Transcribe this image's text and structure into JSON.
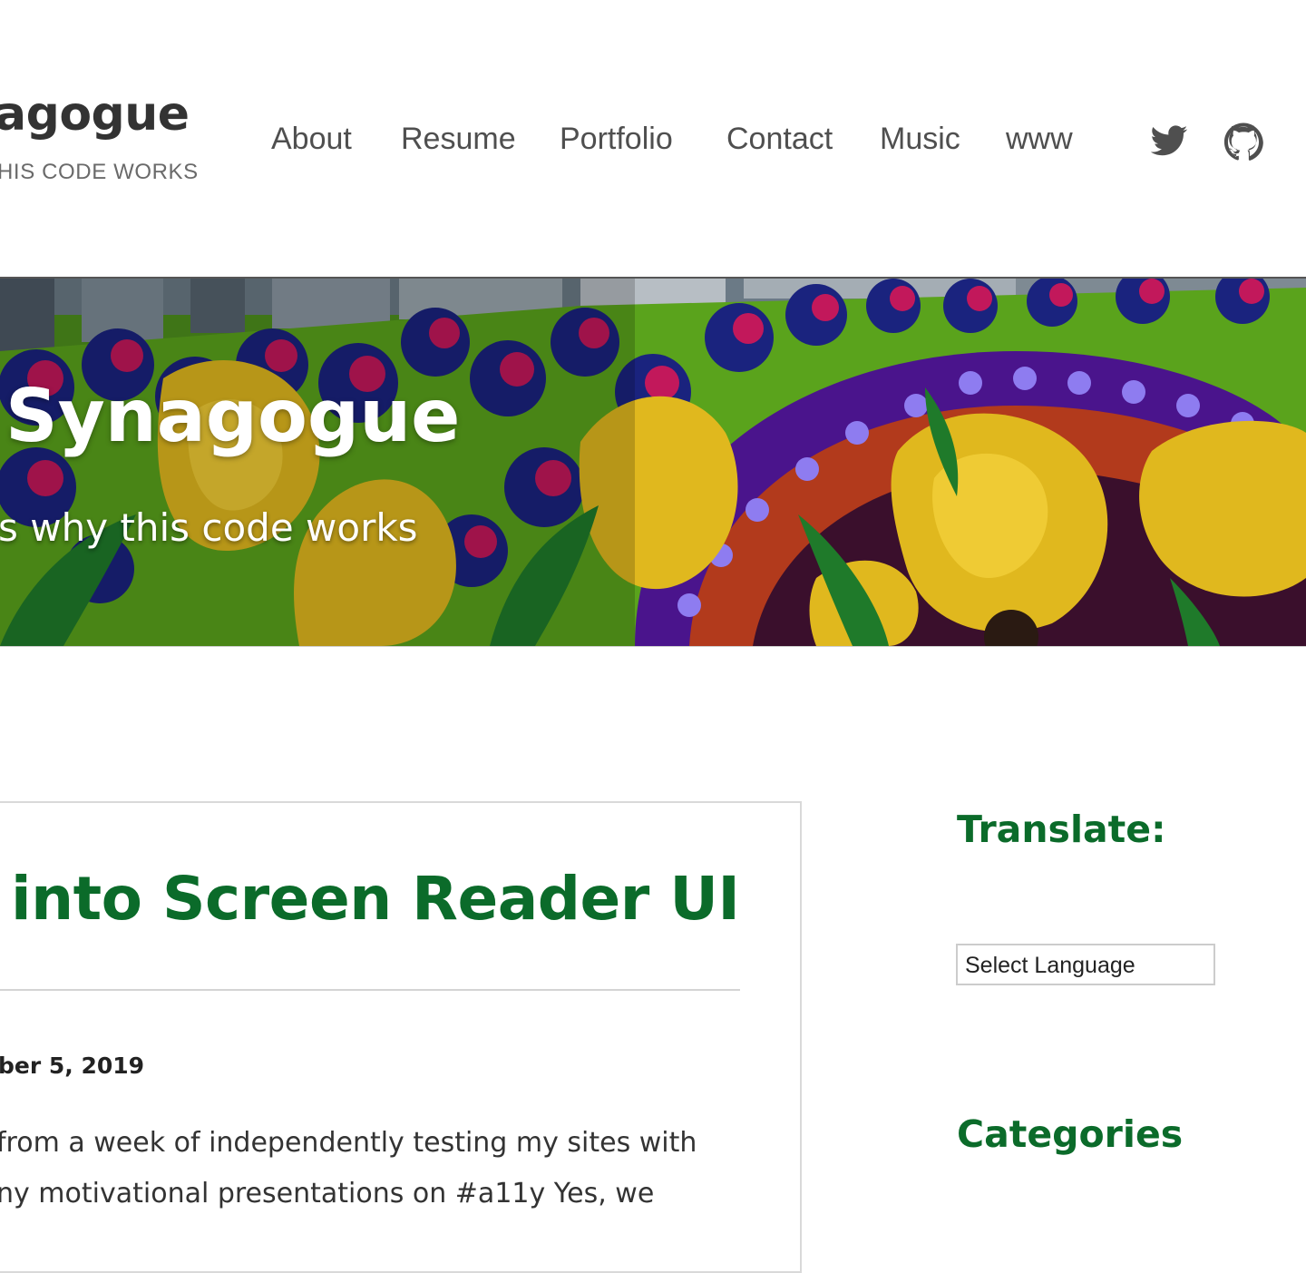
{
  "header": {
    "site_title": "agogue",
    "tagline": "HIS CODE WORKS",
    "nav": [
      "About",
      "Resume",
      "Portfolio",
      "Contact",
      "Music",
      "www"
    ],
    "social_icons": [
      "twitter-icon",
      "github-icon"
    ]
  },
  "hero": {
    "title": "Synagogue",
    "subtitle": "s why this code works"
  },
  "article": {
    "title": "into Screen Reader UI",
    "date": "ber 5, 2019",
    "excerpt_lines": [
      "from a week of independently testing my sites with",
      "ny motivational presentations on #a11y Yes, we"
    ]
  },
  "sidebar": {
    "translate_title": "Translate:",
    "language_select": "Select Language",
    "categories_title": "Categories"
  },
  "colors": {
    "accent_green": "#0b6b2a",
    "nav_text": "#4f4f4f",
    "title_text": "#333333"
  }
}
